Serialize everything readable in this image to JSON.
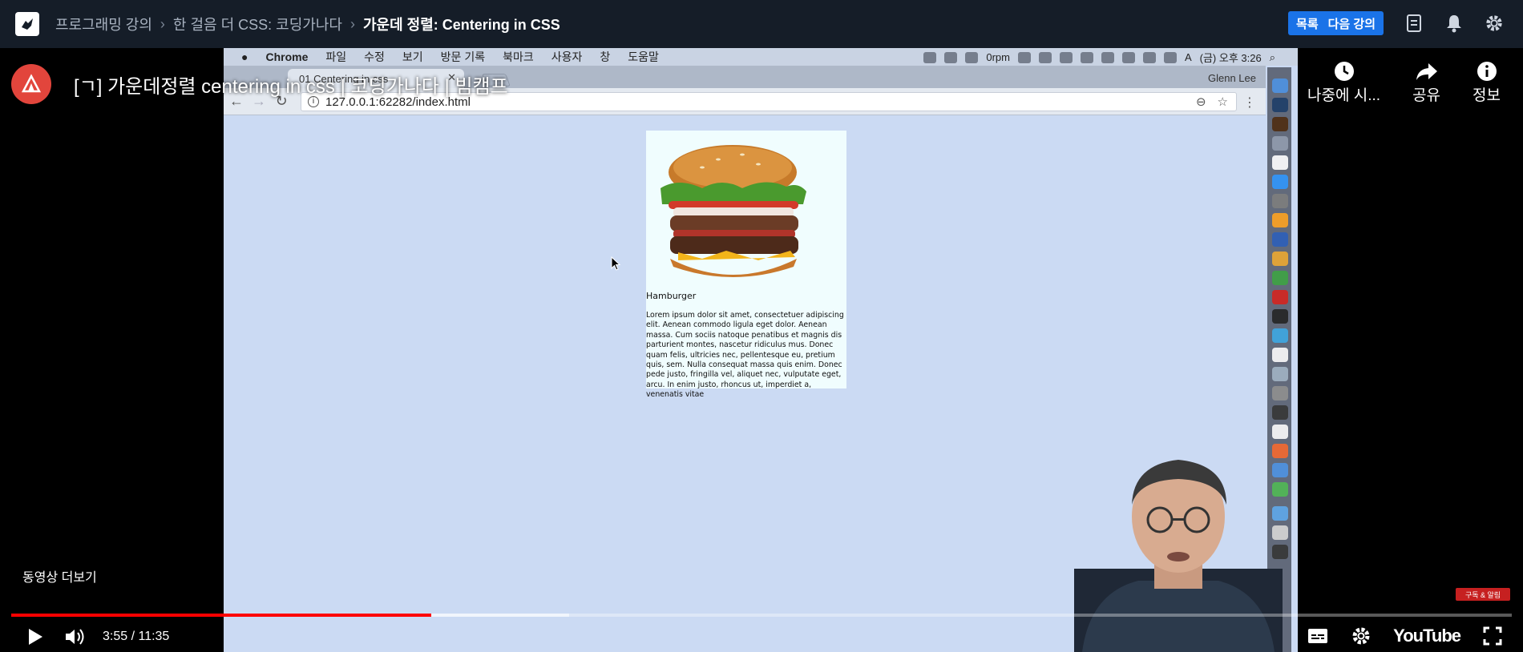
{
  "header": {
    "breadcrumb": [
      "프로그래밍 강의",
      "한 걸음 더 CSS: 코딩가나다",
      "가운데 정렬: Centering in CSS"
    ],
    "list_label": "목록",
    "next_label": "다음 강의"
  },
  "video": {
    "title": "[ㄱ] 가운데정렬 centering in css | 코딩가나다 | 빔캠프",
    "watch_later": "나중에 시...",
    "share": "공유",
    "info": "정보",
    "more_videos": "동영상 더보기",
    "time": "3:55 / 11:35",
    "progress_played": 0.28,
    "progress_buffered": 0.372,
    "youtube_label": "YouTube",
    "subscribe_badge": "구독 & 알림"
  },
  "mac": {
    "menus": [
      "Chrome",
      "파일",
      "수정",
      "보기",
      "방문 기록",
      "북마크",
      "사용자",
      "창",
      "도움말"
    ],
    "rpm": "0rpm",
    "clock": "(금) 오후 3:26",
    "input": "A"
  },
  "browser": {
    "tab_title": "01 Centering in css",
    "user": "Glenn Lee",
    "url": "127.0.0.1:62282/index.html"
  },
  "page": {
    "heading": "Hamburger",
    "body": "Lorem ipsum dolor sit amet, consectetuer adipiscing elit. Aenean commodo ligula eget dolor. Aenean massa. Cum sociis natoque penatibus et magnis dis parturient montes, nascetur ridiculus mus. Donec quam felis, ultricies nec, pellentesque eu, pretium quis, sem. Nulla consequat massa quis enim. Donec pede justo, fringilla vel, aliquet nec, vulputate eget, arcu. In enim justo, rhoncus ut, imperdiet a, venenatis vitae"
  },
  "colors": {
    "accent": "#1a73e8",
    "progress": "#ff0000",
    "screen_bg": "#cbdaf3",
    "card_bg": "#f0fdfe"
  }
}
